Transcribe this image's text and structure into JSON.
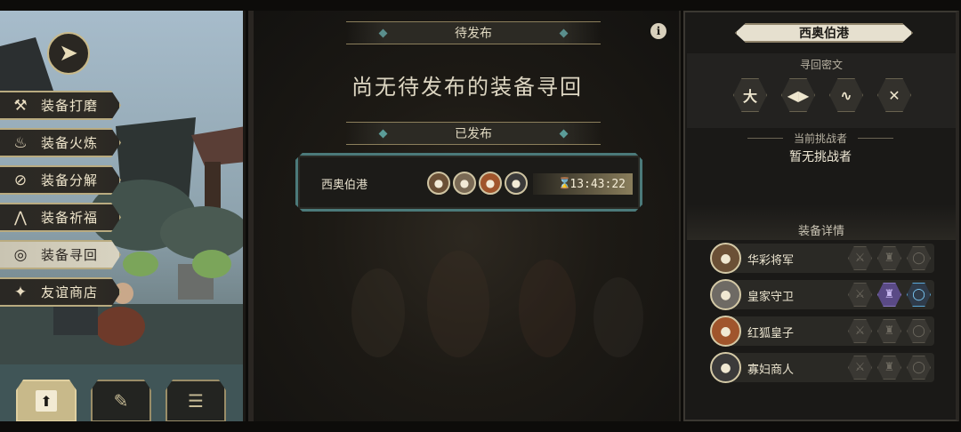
{
  "left_menu": {
    "back_icon": "back-arrow-icon",
    "items": [
      {
        "label": "装备打磨",
        "icon": "hammer-icon",
        "glyph": "⚒",
        "active": false
      },
      {
        "label": "装备火炼",
        "icon": "flame-icon",
        "glyph": "♨",
        "active": false
      },
      {
        "label": "装备分解",
        "icon": "disassemble-icon",
        "glyph": "⊘",
        "active": false
      },
      {
        "label": "装备祈福",
        "icon": "bless-icon",
        "glyph": "⋀",
        "active": false
      },
      {
        "label": "装备寻回",
        "icon": "retrieve-icon",
        "glyph": "◎",
        "active": true
      },
      {
        "label": "友谊商店",
        "icon": "fox-shop-icon",
        "glyph": "✦",
        "active": false
      }
    ],
    "bottom_tabs": [
      {
        "icon": "upload-icon",
        "active": true
      },
      {
        "icon": "feather-icon",
        "active": false
      },
      {
        "icon": "list-icon",
        "active": false
      }
    ]
  },
  "center": {
    "pending_title": "待发布",
    "pending_empty": "尚无待发布的装备寻回",
    "published_title": "已发布",
    "published_items": [
      {
        "location": "西奥伯港",
        "challengers": [
          "avatar-1",
          "avatar-2",
          "avatar-3",
          "avatar-4"
        ],
        "timer": "13:43:22"
      }
    ]
  },
  "right": {
    "location": "西奥伯港",
    "cipher_title": "寻回密文",
    "ciphers": [
      "大",
      "◀▶",
      "∿",
      "✕"
    ],
    "challenger_title": "当前挑战者",
    "challenger_value": "暂无挑战者",
    "equip_title": "装备详情",
    "equipment": [
      {
        "name": "华彩将军",
        "slots": [
          "empty",
          "empty",
          "empty"
        ]
      },
      {
        "name": "皇家守卫",
        "slots": [
          "empty",
          "armor",
          "ring"
        ]
      },
      {
        "name": "红狐皇子",
        "slots": [
          "empty",
          "empty",
          "empty"
        ]
      },
      {
        "name": "寡妇商人",
        "slots": [
          "empty",
          "empty",
          "empty"
        ]
      }
    ]
  },
  "colors": {
    "accent_gold": "#c8b98a",
    "teal_border": "#4b7a7a",
    "armor_purple": "#5a4a86",
    "ring_blue": "#7fd0ff"
  }
}
